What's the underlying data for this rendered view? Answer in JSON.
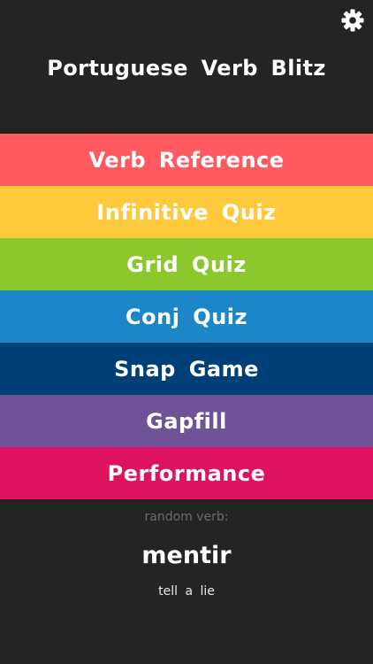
{
  "app": {
    "title": "Portuguese Verb Blitz"
  },
  "header": {
    "settings_icon": "gear-icon"
  },
  "menu": {
    "items": [
      {
        "label": "Verb Reference",
        "color": "#FF5A5F"
      },
      {
        "label": "Infinitive Quiz",
        "color": "#FFC93C"
      },
      {
        "label": "Grid Quiz",
        "color": "#8CC72C"
      },
      {
        "label": "Conj Quiz",
        "color": "#1B86C8"
      },
      {
        "label": "Snap Game",
        "color": "#004079"
      },
      {
        "label": "Gapfill",
        "color": "#6E5396"
      },
      {
        "label": "Performance",
        "color": "#DE1360"
      }
    ]
  },
  "random": {
    "label": "random verb:",
    "verb": "mentir",
    "meaning": "tell a lie"
  },
  "colors": {
    "background": "#242424",
    "muted_text": "#6A6A6A"
  }
}
